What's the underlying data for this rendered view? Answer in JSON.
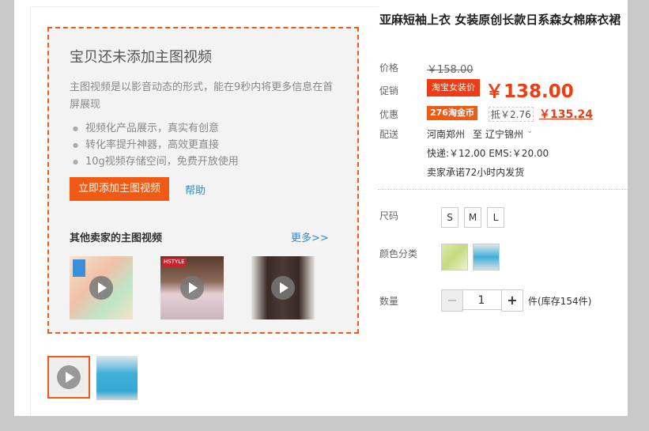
{
  "video_box": {
    "title": "宝贝还未添加主图视频",
    "description": "主图视频是以影音动态的形式，能在9秒内将更多信息在首屏展现",
    "features": [
      "视频化产品展示，真实有创意",
      "转化率提升神器，高效更直接",
      "10g视频存储空间，免费开放使用"
    ],
    "add_button": "立即添加主图视频",
    "help_link": "帮助",
    "other_sellers_title": "其他卖家的主图视频",
    "more_link": "更多>>",
    "thumb_badge_2": "HSTYLE"
  },
  "product": {
    "title": "亚麻短袖上衣 女装原创长款日系森女棉麻衣裙",
    "price_label": "价格",
    "original_price": "￥158.00",
    "promo_label": "促销",
    "promo_tag": "淘宝女装价",
    "promo_price": "￥138.00",
    "coupon_label": "优惠",
    "coin_tag": "276淘金币",
    "coin_deduct": "抵￥2.76",
    "coin_price": "￥135.24",
    "shipping_label": "配送",
    "ship_from": "河南郑州",
    "ship_to_word": "至",
    "ship_to": "辽宁锦州",
    "shipping_cost": "快递:￥12.00   EMS:￥20.00",
    "promise": "卖家承诺72小时内发货",
    "size_label": "尺码",
    "sizes": [
      "S",
      "M",
      "L"
    ],
    "color_label": "颜色分类",
    "quantity_label": "数量",
    "quantity": "1",
    "minus": "−",
    "plus": "+",
    "stock": "件(库存154件)"
  },
  "colors": {
    "accent": "#f05a14",
    "price_red": "#f03c14",
    "link_blue": "#3388cc"
  }
}
